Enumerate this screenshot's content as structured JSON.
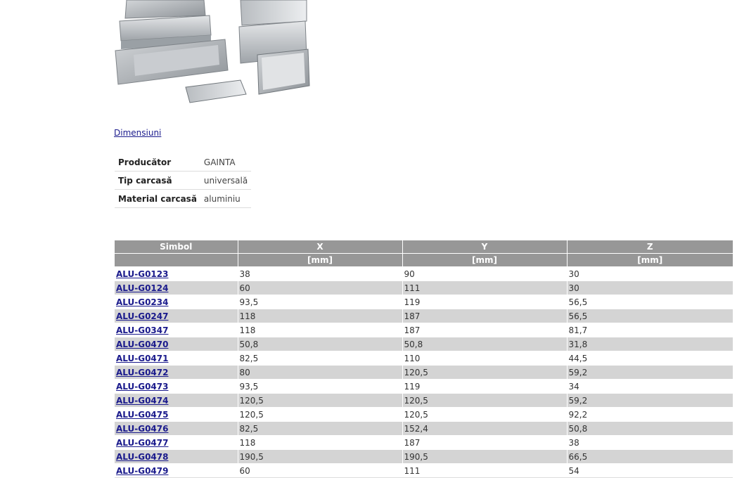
{
  "dimensions_link": "Dimensiuni",
  "properties": [
    {
      "label": "Producător",
      "value": "GAINTA"
    },
    {
      "label": "Tip carcasă",
      "value": "universală"
    },
    {
      "label": "Material carcasă",
      "value": "aluminiu"
    }
  ],
  "table": {
    "headers": [
      "Simbol",
      "X",
      "Y",
      "Z"
    ],
    "units": [
      "",
      "[mm]",
      "[mm]",
      "[mm]"
    ],
    "rows": [
      [
        "ALU-G0123",
        "38",
        "90",
        "30"
      ],
      [
        "ALU-G0124",
        "60",
        "111",
        "30"
      ],
      [
        "ALU-G0234",
        "93,5",
        "119",
        "56,5"
      ],
      [
        "ALU-G0247",
        "118",
        "187",
        "56,5"
      ],
      [
        "ALU-G0347",
        "118",
        "187",
        "81,7"
      ],
      [
        "ALU-G0470",
        "50,8",
        "50,8",
        "31,8"
      ],
      [
        "ALU-G0471",
        "82,5",
        "110",
        "44,5"
      ],
      [
        "ALU-G0472",
        "80",
        "120,5",
        "59,2"
      ],
      [
        "ALU-G0473",
        "93,5",
        "119",
        "34"
      ],
      [
        "ALU-G0474",
        "120,5",
        "120,5",
        "59,2"
      ],
      [
        "ALU-G0475",
        "120,5",
        "120,5",
        "92,2"
      ],
      [
        "ALU-G0476",
        "82,5",
        "152,4",
        "50,8"
      ],
      [
        "ALU-G0477",
        "118",
        "187",
        "38"
      ],
      [
        "ALU-G0478",
        "190,5",
        "190,5",
        "66,5"
      ],
      [
        "ALU-G0479",
        "60",
        "111",
        "54"
      ]
    ]
  }
}
